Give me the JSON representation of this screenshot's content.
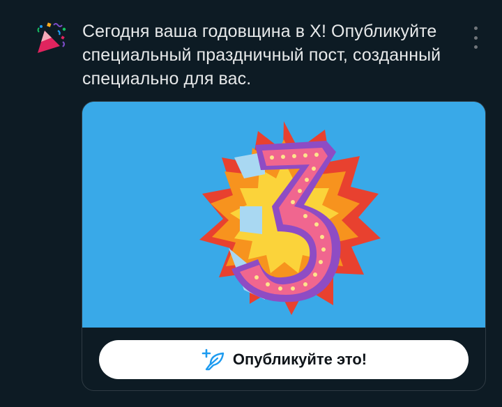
{
  "notification": {
    "icon": "party-popper-icon",
    "message": "Сегодня ваша годовщина в X! Опубликуйте специальный праздничный пост, созданный специально для вас.",
    "menu_icon": "more-vertical-icon"
  },
  "card": {
    "image_subject": "anniversary-number-3-illustration",
    "anniversary_number": "3",
    "button_icon": "compose-feather-icon",
    "button_label": "Опубликуйте это!"
  },
  "colors": {
    "background": "#0d1b24",
    "text": "#e7e9ea",
    "muted": "#71767b",
    "card_image_bg": "#39a9e8",
    "button_bg": "#ffffff",
    "accent": "#1d9bf0"
  }
}
